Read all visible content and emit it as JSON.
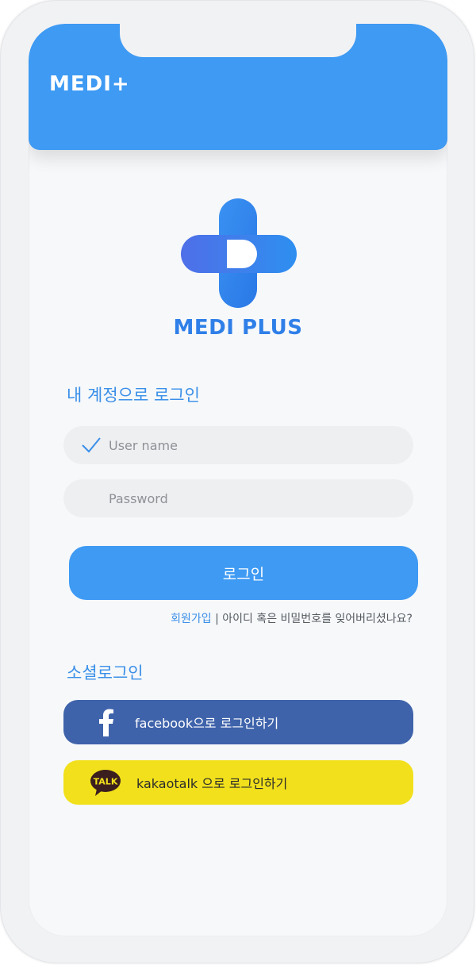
{
  "header": {
    "brand": "MEDI+"
  },
  "logo": {
    "text": "MEDI PLUS"
  },
  "login": {
    "title": "내 계정으로 로그인",
    "username_placeholder": "User name",
    "password_placeholder": "Password",
    "button_label": "로그인",
    "signup_link": "회원가입",
    "separator": " | ",
    "forgot_link": "아이디 혹은 비밀번호를 잊어버리셨나요?"
  },
  "social": {
    "title": "소셜로그인",
    "facebook_label": "facebook으로 로그인하기",
    "kakao_label": "kakaotalk 으로 로그인하기",
    "kakao_icon_text": "TALK"
  },
  "colors": {
    "primary": "#3e9af3",
    "facebook": "#3f63ab",
    "kakao": "#f1e01b",
    "background": "#f6f8fa"
  }
}
